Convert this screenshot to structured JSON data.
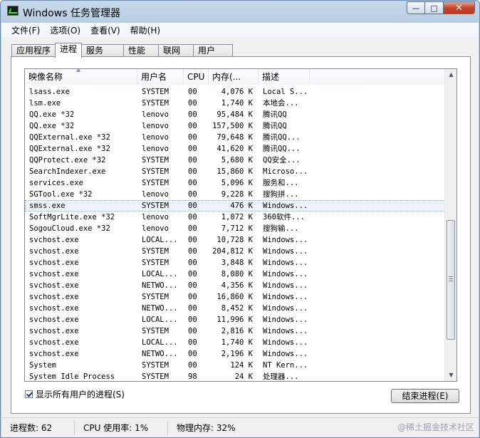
{
  "window": {
    "title": "Windows 任务管理器"
  },
  "caption": {
    "min": "—",
    "max": "□",
    "close": "✕"
  },
  "menu": [
    "文件(F)",
    "选项(O)",
    "查看(V)",
    "帮助(H)"
  ],
  "tabs": [
    "应用程序",
    "进程",
    "服务",
    "性能",
    "联网",
    "用户"
  ],
  "active_tab": 1,
  "columns": [
    "映像名称",
    "用户名",
    "CPU",
    "内存(...",
    "描述"
  ],
  "rows": [
    [
      "lsass.exe",
      "SYSTEM",
      "00",
      "4,076 K",
      "Local S..."
    ],
    [
      "lsm.exe",
      "SYSTEM",
      "00",
      "1,740 K",
      "本地会..."
    ],
    [
      "QQ.exe *32",
      "lenovo",
      "00",
      "95,484 K",
      "腾讯QQ"
    ],
    [
      "QQ.exe *32",
      "lenovo",
      "00",
      "157,500 K",
      "腾讯QQ"
    ],
    [
      "QQExternal.exe *32",
      "lenovo",
      "00",
      "79,648 K",
      "腾讯QQ..."
    ],
    [
      "QQExternal.exe *32",
      "lenovo",
      "00",
      "41,620 K",
      "腾讯QQ..."
    ],
    [
      "QQProtect.exe *32",
      "SYSTEM",
      "00",
      "5,680 K",
      "QQ安全..."
    ],
    [
      "SearchIndexer.exe",
      "SYSTEM",
      "00",
      "15,860 K",
      "Microso..."
    ],
    [
      "services.exe",
      "SYSTEM",
      "00",
      "5,096 K",
      "服务和..."
    ],
    [
      "SGTool.exe *32",
      "lenovo",
      "00",
      "9,228 K",
      "搜狗拼..."
    ],
    [
      "smss.exe",
      "SYSTEM",
      "00",
      "476 K",
      "Windows..."
    ],
    [
      "SoftMgrLite.exe *32",
      "lenovo",
      "00",
      "1,072 K",
      "360软件..."
    ],
    [
      "SogouCloud.exe *32",
      "lenovo",
      "00",
      "7,712 K",
      "搜狗输..."
    ],
    [
      "svchost.exe",
      "LOCAL...",
      "00",
      "10,728 K",
      "Windows..."
    ],
    [
      "svchost.exe",
      "SYSTEM",
      "00",
      "204,812 K",
      "Windows..."
    ],
    [
      "svchost.exe",
      "SYSTEM",
      "00",
      "3,848 K",
      "Windows..."
    ],
    [
      "svchost.exe",
      "LOCAL...",
      "00",
      "8,080 K",
      "Windows..."
    ],
    [
      "svchost.exe",
      "NETWO...",
      "00",
      "4,356 K",
      "Windows..."
    ],
    [
      "svchost.exe",
      "SYSTEM",
      "00",
      "16,860 K",
      "Windows..."
    ],
    [
      "svchost.exe",
      "NETWO...",
      "00",
      "8,452 K",
      "Windows..."
    ],
    [
      "svchost.exe",
      "LOCAL...",
      "00",
      "11,996 K",
      "Windows..."
    ],
    [
      "svchost.exe",
      "SYSTEM",
      "00",
      "2,816 K",
      "Windows..."
    ],
    [
      "svchost.exe",
      "LOCAL...",
      "00",
      "1,740 K",
      "Windows..."
    ],
    [
      "svchost.exe",
      "NETWO...",
      "00",
      "2,196 K",
      "Windows..."
    ],
    [
      "System",
      "SYSTEM",
      "00",
      "124 K",
      "NT Kern..."
    ],
    [
      "System Idle Process",
      "SYSTEM",
      "98",
      "24 K",
      "处理器..."
    ]
  ],
  "selected_row": 10,
  "show_all_users": {
    "label": "显示所有用户的进程(S)",
    "checked": true
  },
  "end_process_label": "结束进程(E)",
  "status": {
    "processes": "进程数: 62",
    "cpu": "CPU 使用率: 1%",
    "memory": "物理内存: 32%"
  },
  "watermark": "@稀土掘金技术社区"
}
